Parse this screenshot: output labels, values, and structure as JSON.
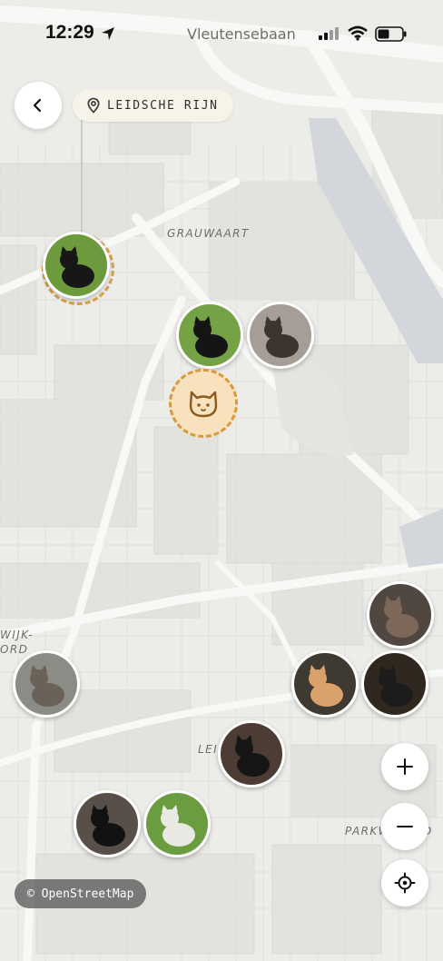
{
  "status_bar": {
    "time": "12:29",
    "street": "Vleutensebaan"
  },
  "header": {
    "area_name": "LEIDSCHE RIJN"
  },
  "map": {
    "labels": {
      "grauwaart": "GRAUWAART",
      "wijk_top": "WIJK-",
      "wijk_bottom": "ORD",
      "lei": "LEI",
      "parkwijk": "PARKW",
      "parkwijk_tail": "D"
    },
    "attribution": "© OpenStreetMap"
  },
  "cats": [
    {
      "name": "black-white cat on grass",
      "fur": "#171717",
      "bg": "#6d9a3d"
    },
    {
      "name": "black-white cat sitting",
      "fur": "#151515",
      "bg": "#74a245"
    },
    {
      "name": "tabby cat lying",
      "fur": "#3d342e",
      "bg": "#a59d96"
    },
    {
      "name": "tortoiseshell cat",
      "fur": "#7d6759",
      "bg": "#504840"
    },
    {
      "name": "ginger cat",
      "fur": "#d9a26c",
      "bg": "#3f3a31"
    },
    {
      "name": "black white cat night",
      "fur": "#1c1c1c",
      "bg": "#30271f"
    },
    {
      "name": "tabby cat street",
      "fur": "#6a6258",
      "bg": "#8c8c86"
    },
    {
      "name": "black cat",
      "fur": "#161616",
      "bg": "#4d3c34"
    },
    {
      "name": "black cat dark",
      "fur": "#121212",
      "bg": "#585048"
    },
    {
      "name": "white cat on grass",
      "fur": "#e9e9e3",
      "bg": "#6a9c40"
    }
  ],
  "colors": {
    "accent": "#d99a3e",
    "accent_fill": "#f7e2bd",
    "map_bg": "#ecece9"
  },
  "icons": {
    "back": "chevron-left-icon",
    "pin": "map-pin-icon",
    "user": "cat-face-icon",
    "zoom_in": "plus-icon",
    "zoom_out": "minus-icon",
    "locate": "locate-crosshair-icon"
  }
}
